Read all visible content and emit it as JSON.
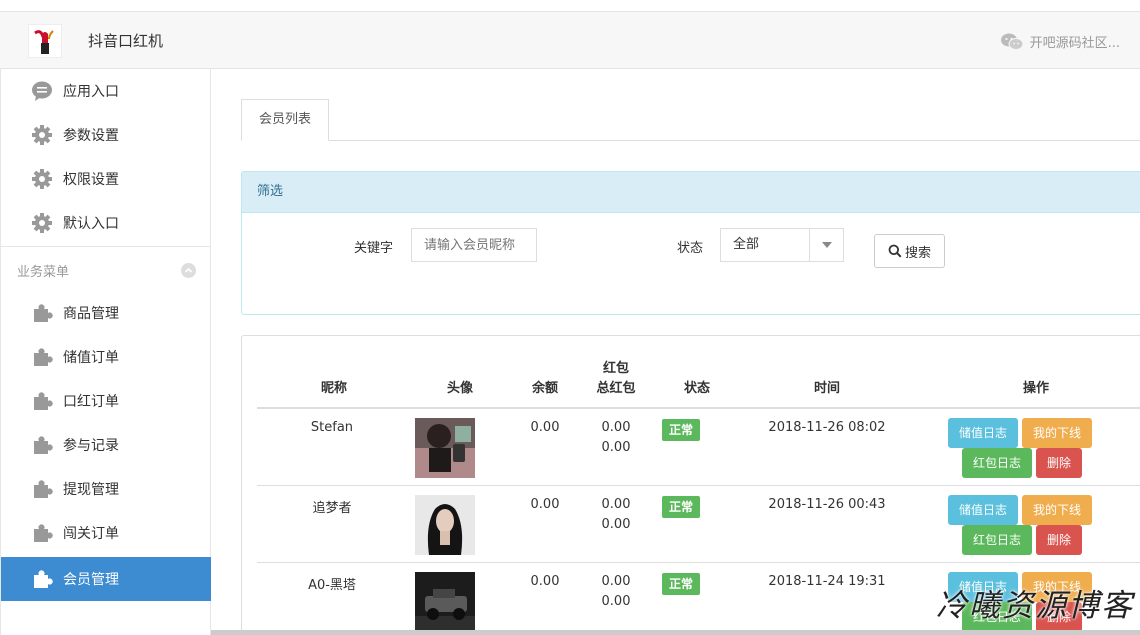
{
  "header": {
    "app_title": "抖音口红机",
    "community_label": "开吧源码社区..."
  },
  "sidebar": {
    "items": [
      {
        "label": "应用入口",
        "icon": "chat-icon"
      },
      {
        "label": "参数设置",
        "icon": "gear-icon"
      },
      {
        "label": "权限设置",
        "icon": "gear-icon"
      },
      {
        "label": "默认入口",
        "icon": "gear-icon"
      }
    ],
    "group_title": "业务菜单",
    "group_items": [
      {
        "label": "商品管理",
        "icon": "puzzle-icon"
      },
      {
        "label": "储值订单",
        "icon": "puzzle-icon"
      },
      {
        "label": "口红订单",
        "icon": "puzzle-icon"
      },
      {
        "label": "参与记录",
        "icon": "puzzle-icon"
      },
      {
        "label": "提现管理",
        "icon": "puzzle-icon"
      },
      {
        "label": "闯关订单",
        "icon": "puzzle-icon"
      },
      {
        "label": "会员管理",
        "icon": "puzzle-icon",
        "active": true
      }
    ]
  },
  "tabs": {
    "member_list": "会员列表"
  },
  "filter": {
    "title": "筛选",
    "keyword_label": "关键字",
    "keyword_placeholder": "请输入会员昵称",
    "status_label": "状态",
    "status_value": "全部",
    "search_label": "搜索"
  },
  "table": {
    "headers": {
      "nickname": "昵称",
      "avatar": "头像",
      "balance": "余额",
      "redpacket": "红包",
      "total_redpacket": "总红包",
      "status": "状态",
      "time": "时间",
      "actions": "操作"
    },
    "rows": [
      {
        "nickname": "Stefan",
        "balance": "0.00",
        "redpacket": "0.00",
        "total_redpacket": "0.00",
        "status": "正常",
        "time": "2018-11-26 08:02"
      },
      {
        "nickname": "追梦者",
        "balance": "0.00",
        "redpacket": "0.00",
        "total_redpacket": "0.00",
        "status": "正常",
        "time": "2018-11-26 00:43"
      },
      {
        "nickname": "A0-黑塔",
        "balance": "0.00",
        "redpacket": "0.00",
        "total_redpacket": "0.00",
        "status": "正常",
        "time": "2018-11-24 19:31"
      }
    ],
    "actions": {
      "deposit_log": "储值日志",
      "my_downline": "我的下线",
      "redpacket_log": "红包日志",
      "delete": "删除"
    }
  },
  "watermark": "冷曦资源博客",
  "colors": {
    "active_nav": "#3d8bd0",
    "status_ok": "#5cb85c",
    "info": "#5bc0de",
    "warning": "#f0ad4e",
    "danger": "#d9534f",
    "filter_head": "#d9edf7"
  }
}
